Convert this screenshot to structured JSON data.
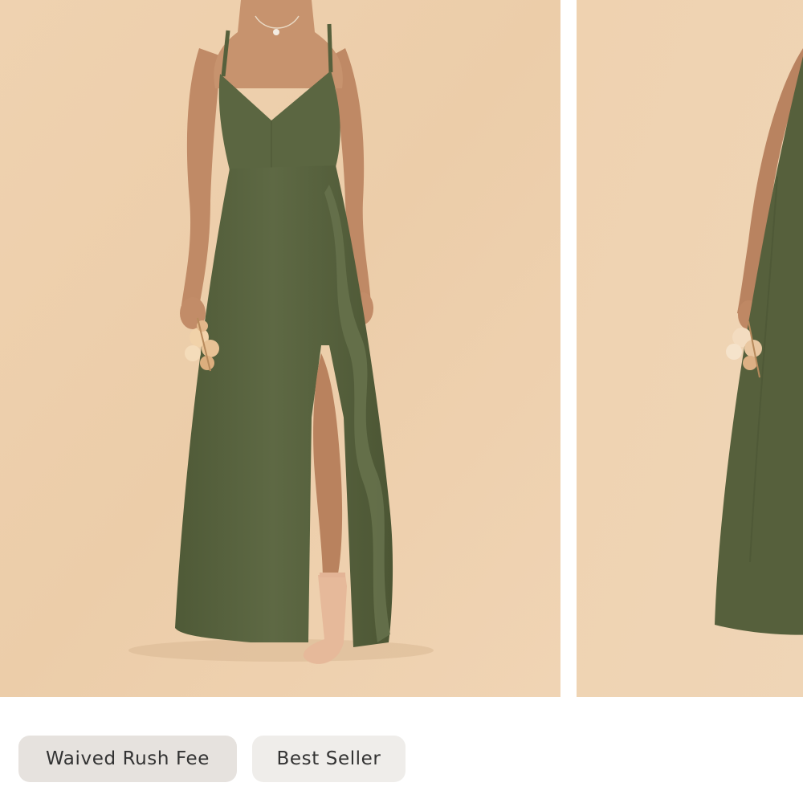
{
  "product": {
    "images": [
      {
        "alt": "Model wearing olive green chiffon maxi dress with slit and ruffle, holding dried flowers"
      },
      {
        "alt": "Side view of olive green dress"
      }
    ],
    "badges": [
      {
        "label": "Waived Rush Fee"
      },
      {
        "label": "Best Seller"
      }
    ]
  },
  "colors": {
    "backdrop": "#edcfac",
    "dress": "#5a6440",
    "skin": "#c18c68",
    "badge_primary": "#e6e2de",
    "badge_secondary": "#efedea",
    "badge_text": "#333333"
  }
}
